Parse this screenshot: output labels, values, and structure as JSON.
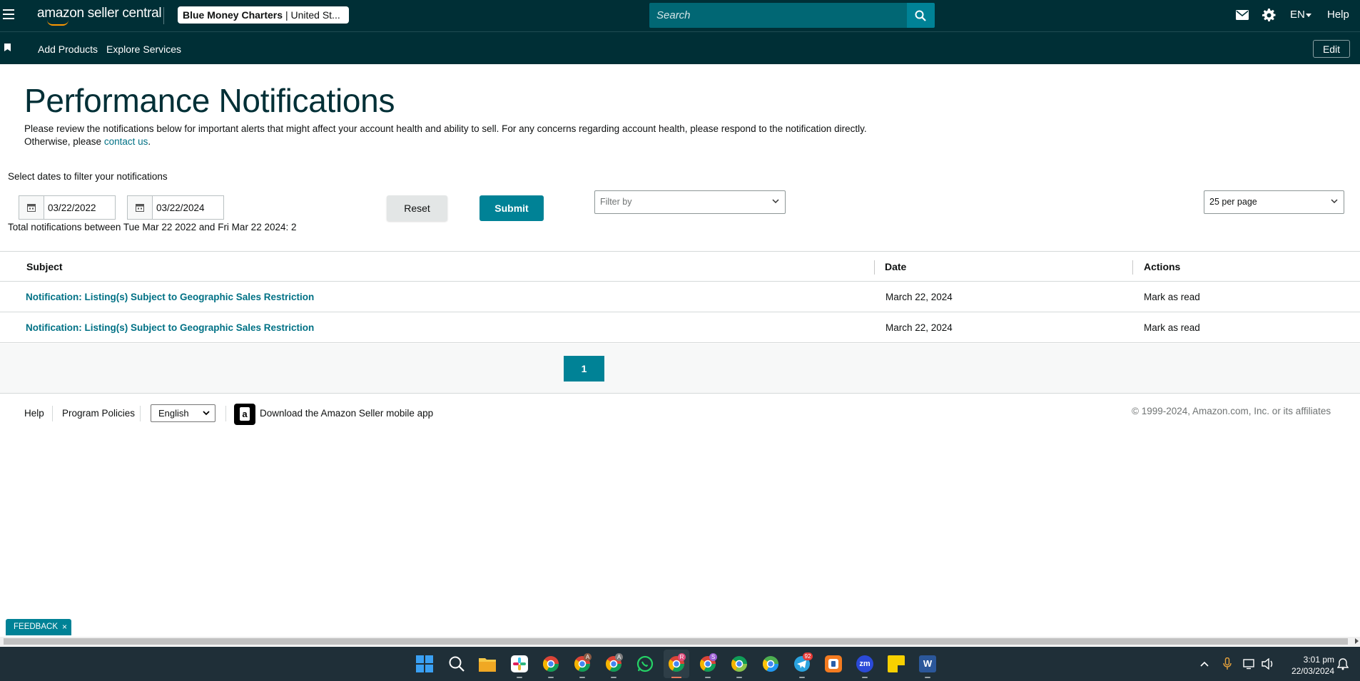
{
  "header": {
    "logo_text": "amazon seller central",
    "account": {
      "name": "Blue Money Charters",
      "region": "| United St..."
    },
    "search_placeholder": "Search",
    "language": "EN",
    "help_label": "Help"
  },
  "nav": {
    "items": [
      "Add Products",
      "Explore Services"
    ],
    "edit_label": "Edit"
  },
  "page": {
    "title": "Performance Notifications",
    "intro_text": "Please review the notifications below for important alerts that might affect your account health and ability to sell. For any concerns regarding account health, please respond to the notification directly. Otherwise, please ",
    "intro_link": "contact us",
    "intro_end": "."
  },
  "filters": {
    "date_label": "Select dates to filter your notifications",
    "start_date": "03/22/2022",
    "end_date": "03/22/2024",
    "total_text": "Total notifications between Tue Mar 22 2022 and Fri Mar 22 2024: 2",
    "reset_label": "Reset",
    "submit_label": "Submit",
    "filter_by_placeholder": "Filter by",
    "per_page": "25 per page"
  },
  "table": {
    "columns": [
      "Subject",
      "Date",
      "Actions"
    ],
    "rows": [
      {
        "subject": "Notification: Listing(s) Subject to Geographic Sales Restriction",
        "date": "March 22, 2024",
        "action": "Mark as read"
      },
      {
        "subject": "Notification: Listing(s) Subject to Geographic Sales Restriction",
        "date": "March 22, 2024",
        "action": "Mark as read"
      }
    ]
  },
  "pagination": {
    "current_page": "1"
  },
  "footer": {
    "help": "Help",
    "program_policies": "Program Policies",
    "language_select": "English",
    "app_text": "Download the Amazon Seller mobile app",
    "copyright": "© 1999-2024, Amazon.com, Inc. or its affiliates"
  },
  "feedback": {
    "label": "FEEDBACK",
    "close": "×"
  },
  "taskbar": {
    "time": "3:01 pm",
    "date": "22/03/2024",
    "telegram_badge": "92",
    "chrome_badges": [
      "A",
      "A",
      "R",
      "S"
    ]
  },
  "colors": {
    "header_bg": "#002f36",
    "accent_teal": "#008296",
    "link_teal": "#007185",
    "logo_smile": "#ff9900"
  }
}
